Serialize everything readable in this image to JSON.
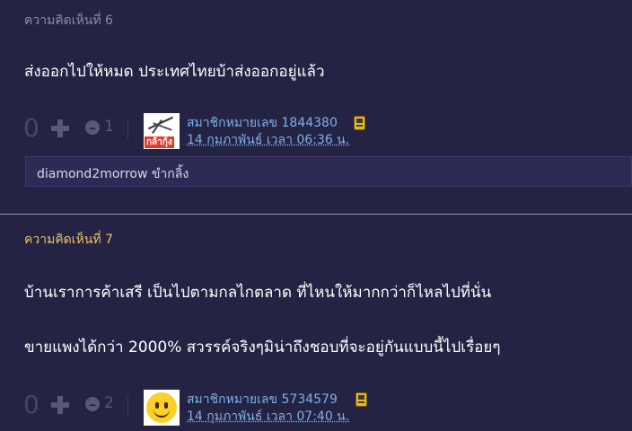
{
  "comments": [
    {
      "label": "ความคิดเห็นที่ 6",
      "lines": [
        "ส่งออกไปให้หมด ประเทศไทยบ้าส่งออกอยู่แล้ว"
      ],
      "score": "0",
      "emoji_icon": "emoji-icon",
      "emoji_count": "1",
      "member_name": "สมาชิกหมายเลข 1844380",
      "timestamp": "14 กุมภาพันธ์ เวลา 06:36 น.",
      "avatar_text": "กล้ากุ้ง",
      "reply": "diamond2morrow ขำกลิ้ง"
    },
    {
      "label": "ความคิดเห็นที่ 7",
      "lines": [
        "บ้านเราการค้าเสรี เป็นไปตามกลไกตลาด  ที่ไหนให้มากกว่าก็ไหลไปที่นั่น",
        "ขายแพงได้กว่า 2000%  สวรรค์จริงๆมิน่าถึงชอบที่จะอยู่กันแบบนี้ไปเรื่อยๆ"
      ],
      "score": "0",
      "emoji_icon": "emoji-icon",
      "emoji_count": "2",
      "member_name": "สมาชิกหมายเลข 5734579",
      "timestamp": "14 กุมภาพันธ์ เวลา 07:40 น."
    }
  ],
  "colors": {
    "background": "#252343",
    "label_highlight": "#e8c36a",
    "link": "#7db1e8"
  }
}
